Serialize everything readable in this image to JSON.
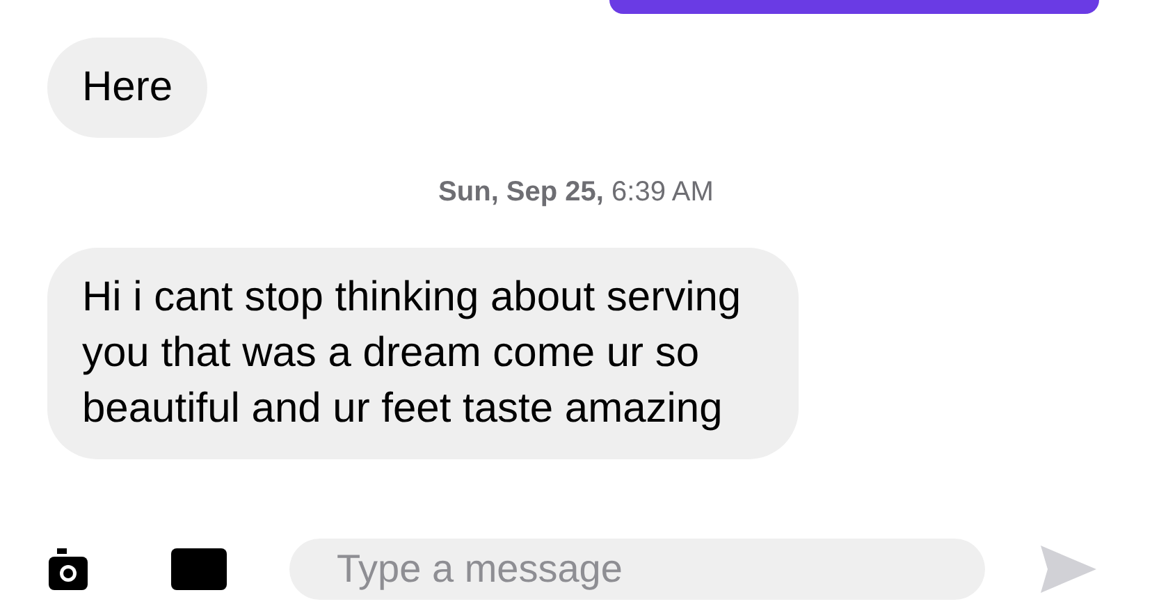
{
  "messages": [
    {
      "kind": "received",
      "text": "Here"
    },
    {
      "kind": "timestamp",
      "date": "Sun, Sep 25,",
      "time": "6:39 AM"
    },
    {
      "kind": "received",
      "text": "Hi i cant stop thinking about serving you that was a dream come ur so beautiful and ur feet taste amazing"
    }
  ],
  "composer": {
    "placeholder": "Type a message"
  }
}
